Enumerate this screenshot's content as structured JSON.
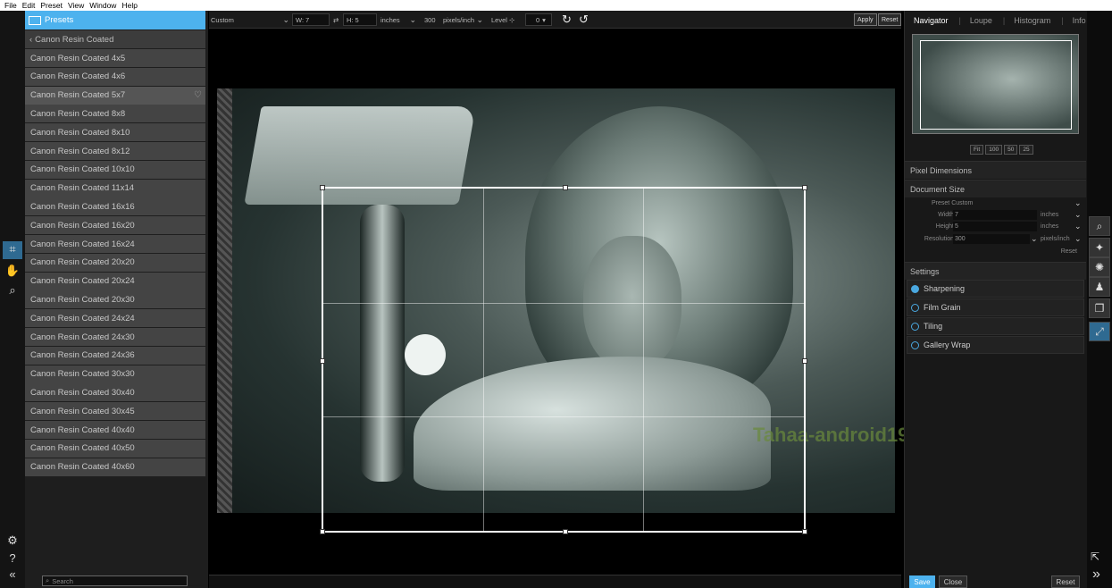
{
  "menu": [
    "File",
    "Edit",
    "Preset",
    "View",
    "Window",
    "Help"
  ],
  "left_tools": {
    "crop": "Crop",
    "hand": "Hand",
    "zoom": "Zoom"
  },
  "presets": {
    "header": "Presets",
    "back": "Canon Resin Coated",
    "items": [
      "Canon Resin Coated 4x5",
      "Canon Resin Coated 4x6",
      "Canon Resin Coated 5x7",
      "Canon Resin Coated 8x8",
      "Canon Resin Coated 8x10",
      "Canon Resin Coated 8x12",
      "Canon Resin Coated 10x10",
      "Canon Resin Coated 11x14",
      "Canon Resin Coated 16x16",
      "Canon Resin Coated 16x20",
      "Canon Resin Coated 16x24",
      "Canon Resin Coated 20x20",
      "Canon Resin Coated 20x24",
      "Canon Resin Coated 20x30",
      "Canon Resin Coated 24x24",
      "Canon Resin Coated 24x30",
      "Canon Resin Coated 24x36",
      "Canon Resin Coated 30x30",
      "Canon Resin Coated 30x40",
      "Canon Resin Coated 30x45",
      "Canon Resin Coated 40x40",
      "Canon Resin Coated 40x50",
      "Canon Resin Coated 40x60"
    ],
    "selected_index": 2,
    "search_placeholder": "Search"
  },
  "toolbar": {
    "preset": "Custom",
    "width_label": "W:",
    "width": "7",
    "height_label": "H:",
    "height": "5",
    "units": "inches",
    "resolution": "300",
    "res_units": "pixels/inch",
    "level_label": "Level",
    "level_value": "0",
    "apply": "Apply",
    "reset": "Reset"
  },
  "watermark": "Tahaa-android19",
  "navigator": {
    "tabs": [
      "Navigator",
      "Loupe",
      "Histogram",
      "Info"
    ],
    "active_tab": "Navigator",
    "zoom_buttons": [
      "Fit",
      "100",
      "50",
      "25"
    ]
  },
  "sections": {
    "pixel_dimensions": "Pixel Dimensions",
    "document_size": "Document Size",
    "settings": "Settings"
  },
  "document_size": {
    "preset_label": "Preset",
    "preset_value": "Custom",
    "width_label": "Width",
    "width_value": "7",
    "width_units": "inches",
    "height_label": "Height",
    "height_value": "5",
    "height_units": "inches",
    "resolution_label": "Resolution",
    "resolution_value": "300",
    "resolution_units": "pixels/inch",
    "reset": "Reset"
  },
  "settings": [
    {
      "label": "Sharpening",
      "checked": true
    },
    {
      "label": "Film Grain",
      "checked": false
    },
    {
      "label": "Tiling",
      "checked": false
    },
    {
      "label": "Gallery Wrap",
      "checked": false
    }
  ],
  "footer": {
    "save": "Save",
    "close": "Close",
    "reset": "Reset"
  },
  "right_tools": [
    "Browse",
    "Effects",
    "Adjust",
    "Portrait",
    "Layers",
    "Resize"
  ],
  "colors": {
    "accent": "#4db2ee",
    "panel": "#1e1e1e",
    "row": "#444444"
  }
}
